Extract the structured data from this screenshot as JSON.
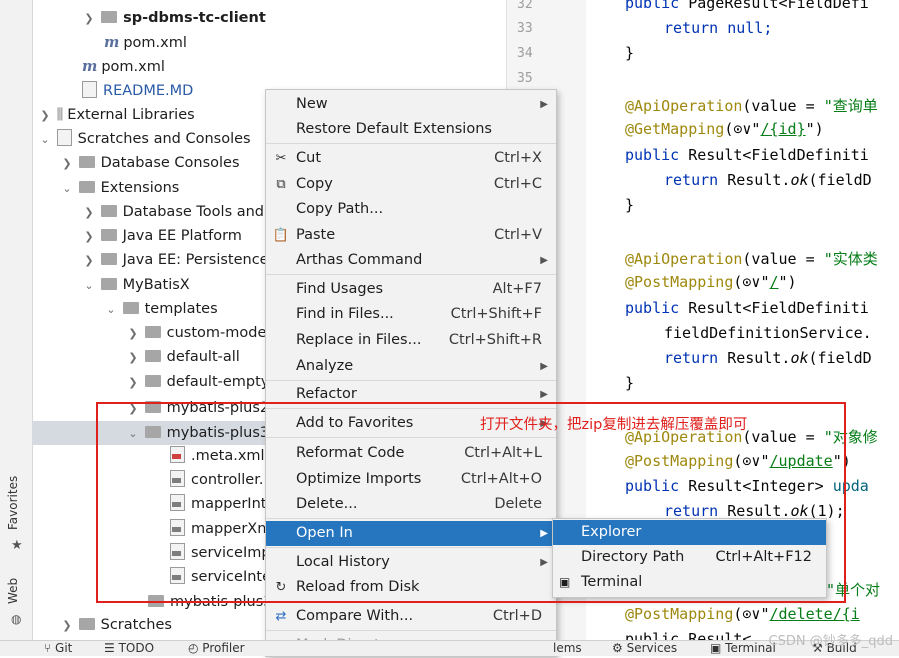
{
  "left_strip": {
    "favorites": "Favorites",
    "web": "Web"
  },
  "tree": {
    "items": [
      {
        "label": "sp-dbms-tc-client",
        "icon": "folder-icon"
      },
      {
        "label": "pom.xml",
        "icon": "maven-icon"
      },
      {
        "label": "pom.xml",
        "icon": "maven-icon"
      },
      {
        "label": "README.MD",
        "icon": "markdown-file-icon"
      },
      {
        "label": "External Libraries",
        "icon": "libraries-icon"
      },
      {
        "label": "Scratches and Consoles",
        "icon": "scratches-icon"
      },
      {
        "label": "Database Consoles",
        "icon": "folder-icon"
      },
      {
        "label": "Extensions",
        "icon": "folder-icon"
      },
      {
        "label": "Database Tools and",
        "icon": "folder-icon"
      },
      {
        "label": "Java EE Platform",
        "icon": "folder-icon"
      },
      {
        "label": "Java EE: Persistence",
        "icon": "folder-icon"
      },
      {
        "label": "MyBatisX",
        "icon": "folder-icon"
      },
      {
        "label": "templates",
        "icon": "folder-icon"
      },
      {
        "label": "custom-mode",
        "icon": "folder-icon"
      },
      {
        "label": "default-all",
        "icon": "folder-icon"
      },
      {
        "label": "default-empty",
        "icon": "folder-icon"
      },
      {
        "label": "mybatis-plus2",
        "icon": "folder-icon"
      },
      {
        "label": "mybatis-plus3",
        "icon": "folder-icon"
      },
      {
        "label": ".meta.xml",
        "icon": "xml-file-icon"
      },
      {
        "label": "controller.",
        "icon": "template-file-icon"
      },
      {
        "label": "mapperInt",
        "icon": "template-file-icon"
      },
      {
        "label": "mapperXn",
        "icon": "template-file-icon"
      },
      {
        "label": "serviceImp",
        "icon": "template-file-icon"
      },
      {
        "label": "serviceInte",
        "icon": "template-file-icon"
      },
      {
        "label": "mybatis-plus3",
        "icon": "folder-icon"
      },
      {
        "label": "Scratches",
        "icon": "folder-icon"
      }
    ]
  },
  "bottom_bar": {
    "git": "Git",
    "todo": "TODO",
    "profiler": "Profiler",
    "problems": "lems",
    "services": "Services",
    "terminal": "Terminal",
    "build": "Build"
  },
  "gutter": {
    "lines": [
      "32",
      "33",
      "34",
      "35"
    ]
  },
  "editor": {
    "l1_kw": "public",
    "l1_rest": "PageResult<FieldDefi",
    "l2_kw": "return",
    "l2_rest": "null;",
    "l3": "}",
    "l4_ann": "@ApiOperation",
    "l4_rest": "(value = ",
    "l4_str": "\"查询单",
    "l5_ann": "@GetMapping",
    "l5_rest": "(⊙∨\"",
    "l5_str": "/{id}",
    "l5_end": "\")",
    "l6_kw": "public",
    "l6_rest": "Result<FieldDefiniti",
    "l7_kw": "return",
    "l7_rest": "Result.",
    "l7_fn": "ok",
    "l7_end": "(fieldD",
    "l8": "}",
    "l9_ann": "@ApiOperation",
    "l9_rest": "(value = ",
    "l9_str": "\"实体类",
    "l10_ann": "@PostMapping",
    "l10_rest": "(⊙∨\"",
    "l10_str": "/",
    "l10_end": "\")",
    "l11_kw": "public",
    "l11_rest": "Result<FieldDefiniti",
    "l12": "fieldDefinitionService.",
    "l13_kw": "return",
    "l13_rest": "Result.",
    "l13_fn": "ok",
    "l13_end": "(fieldD",
    "l14": "}",
    "l15_ann": "@ApiOperation",
    "l15_rest": "(value = ",
    "l15_str": "\"对象修",
    "l16_ann": "@PostMapping",
    "l16_rest": "(⊙∨\"",
    "l16_str": "/update",
    "l16_end": "\")",
    "l17_kw": "public",
    "l17_rest": "Result<Integer> ",
    "l17_fn": "upda",
    "l18_kw": "return",
    "l18_rest": "Result.",
    "l18_fn": "ok",
    "l18_end": "(1);",
    "l19_str": "\"单个对",
    "l20_ann": "@PostMapping",
    "l20_rest": "(⊙∨\"",
    "l20_str": "/delete/{i",
    "l21": "public Result<"
  },
  "context_menu": {
    "items": [
      {
        "label": "New",
        "shortcut": "",
        "submenu": true
      },
      {
        "label": "Restore Default Extensions",
        "shortcut": ""
      },
      {
        "label": "Cut",
        "shortcut": "Ctrl+X",
        "icon": "scissors-icon"
      },
      {
        "label": "Copy",
        "shortcut": "Ctrl+C",
        "icon": "copy-icon"
      },
      {
        "label": "Copy Path...",
        "shortcut": ""
      },
      {
        "label": "Paste",
        "shortcut": "Ctrl+V",
        "icon": "clipboard-icon"
      },
      {
        "label": "Arthas Command",
        "shortcut": "",
        "submenu": true
      },
      {
        "label": "Find Usages",
        "shortcut": "Alt+F7"
      },
      {
        "label": "Find in Files...",
        "shortcut": "Ctrl+Shift+F"
      },
      {
        "label": "Replace in Files...",
        "shortcut": "Ctrl+Shift+R"
      },
      {
        "label": "Analyze",
        "shortcut": "",
        "submenu": true
      },
      {
        "label": "Refactor",
        "shortcut": "",
        "submenu": true
      },
      {
        "label": "Add to Favorites",
        "shortcut": "",
        "submenu": true
      },
      {
        "label": "Reformat Code",
        "shortcut": "Ctrl+Alt+L"
      },
      {
        "label": "Optimize Imports",
        "shortcut": "Ctrl+Alt+O"
      },
      {
        "label": "Delete...",
        "shortcut": "Delete"
      },
      {
        "label": "Open In",
        "shortcut": "",
        "submenu": true
      },
      {
        "label": "Local History",
        "shortcut": "",
        "submenu": true
      },
      {
        "label": "Reload from Disk",
        "shortcut": "",
        "icon": "reload-icon"
      },
      {
        "label": "Compare With...",
        "shortcut": "Ctrl+D",
        "icon": "compare-icon"
      },
      {
        "label": "Mark Directory as",
        "shortcut": "",
        "submenu": true
      }
    ]
  },
  "submenu": {
    "items": [
      {
        "label": "Explorer",
        "shortcut": ""
      },
      {
        "label": "Directory Path",
        "shortcut": "Ctrl+Alt+F12"
      },
      {
        "label": "Terminal",
        "shortcut": "",
        "icon": "terminal-icon"
      }
    ]
  },
  "annotation": {
    "text": "打开文件夹，把zip复制进去解压覆盖即可",
    "color": "#e0201c"
  },
  "watermark": "CSDN @钞多多_qdd",
  "colors": {
    "menu_highlight": "#2675bf",
    "selection_row": "#d5d9e0"
  }
}
